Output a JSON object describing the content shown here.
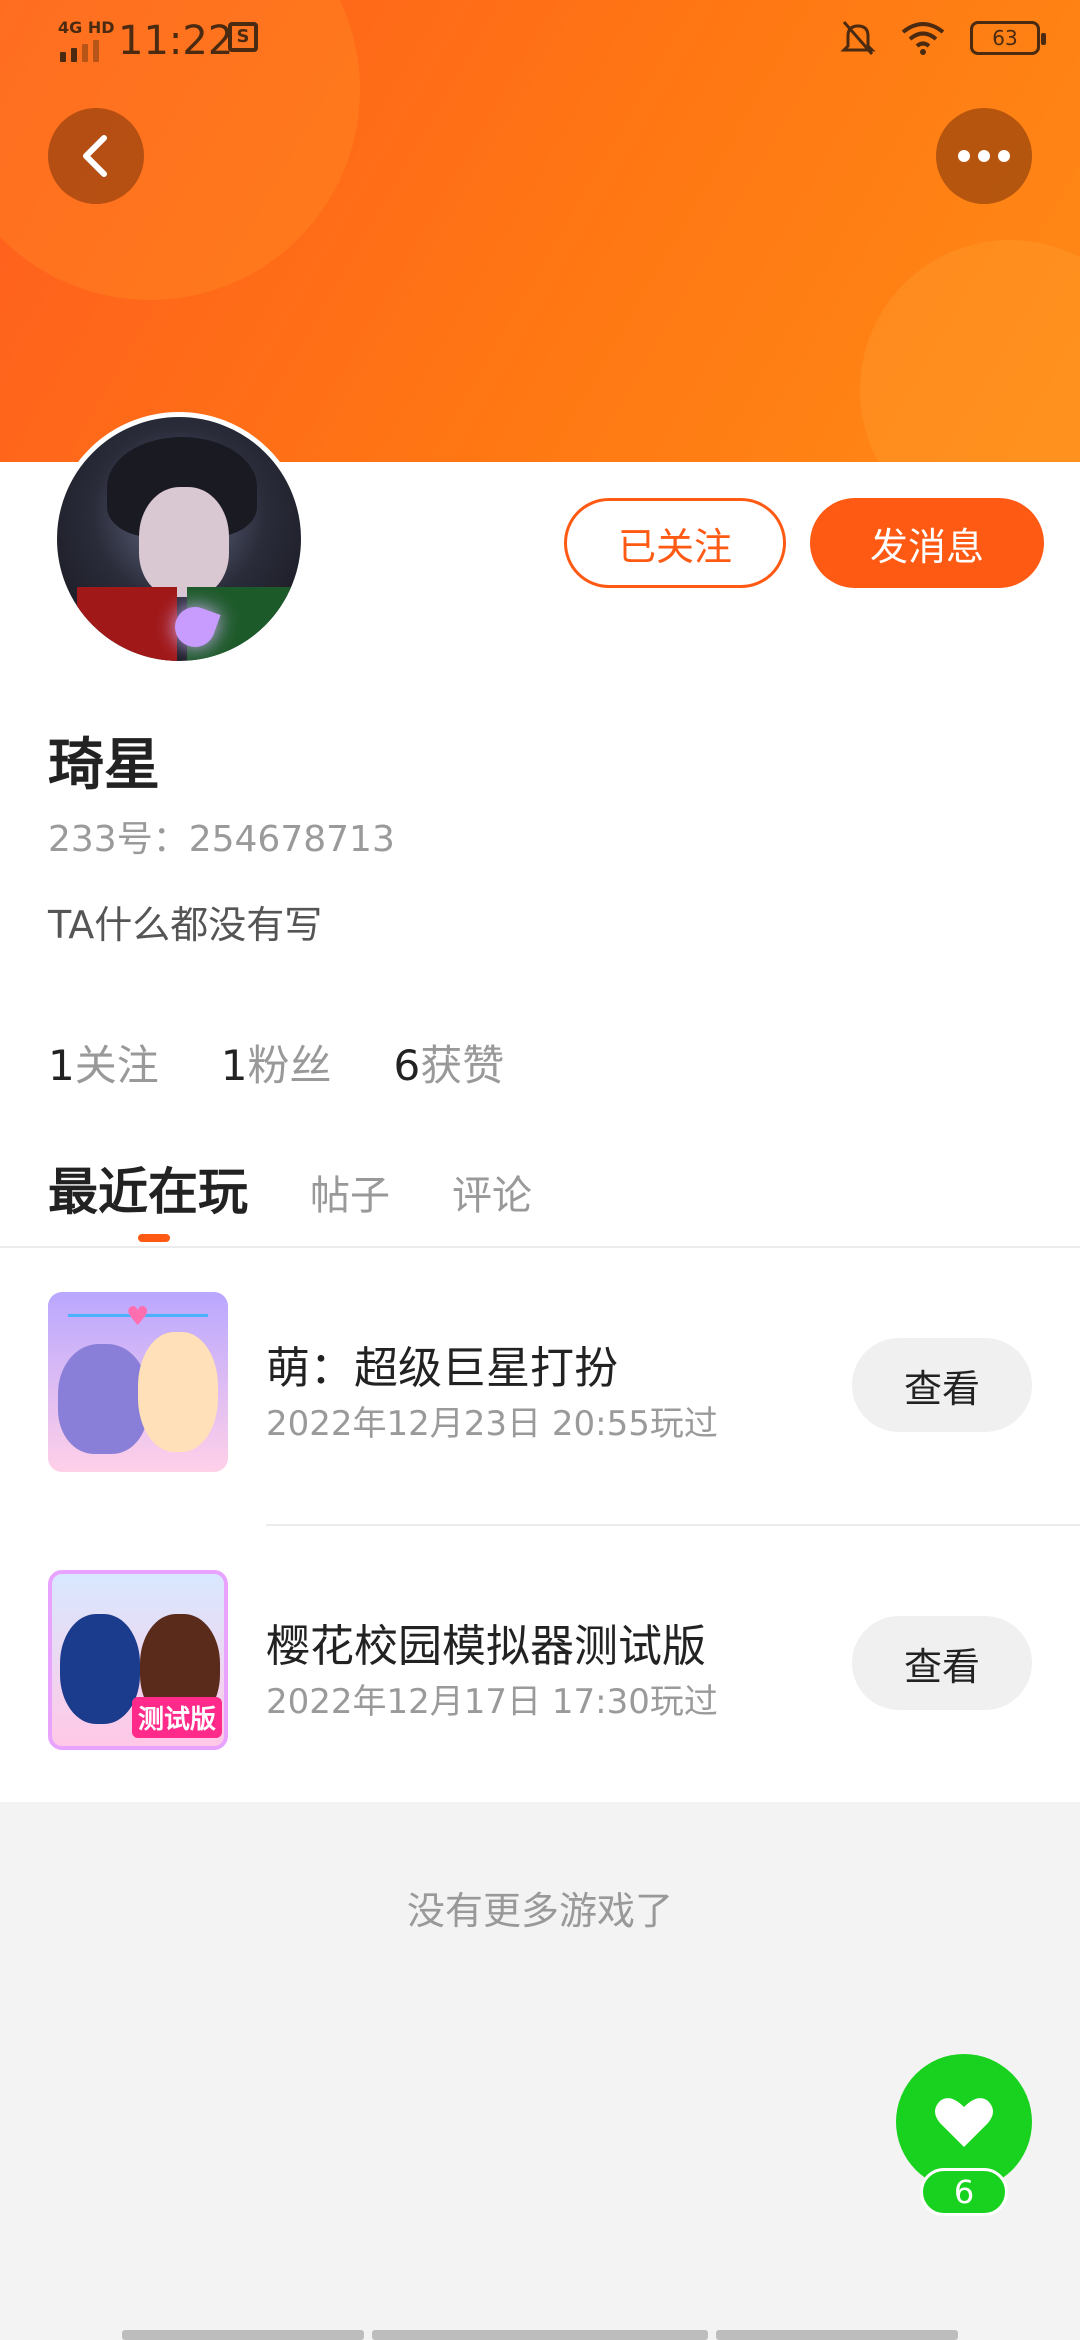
{
  "status_bar": {
    "network": "4G HD",
    "time": "11:22",
    "sim_icon_text": "S",
    "battery": "63"
  },
  "header": {
    "back_icon": "chevron-left-icon",
    "more_icon": "more-dots-icon",
    "gradient_start": "#ff5d1f",
    "gradient_end": "#ff8a16"
  },
  "profile": {
    "username": "琦星",
    "user_id": "233号：254678713",
    "bio": "TA什么都没有写",
    "followed_label": "已关注",
    "message_label": "发消息",
    "stats": [
      {
        "num": "1",
        "label": "关注"
      },
      {
        "num": "1",
        "label": "粉丝"
      },
      {
        "num": "6",
        "label": "获赞"
      }
    ]
  },
  "tabs": [
    {
      "label": "最近在玩",
      "active": true
    },
    {
      "label": "帖子",
      "active": false
    },
    {
      "label": "评论",
      "active": false
    }
  ],
  "games": [
    {
      "title": "萌：超级巨星打扮",
      "played": "2022年12月23日 20:55玩过",
      "action": "查看"
    },
    {
      "title": "樱花校园模拟器测试版",
      "played": "2022年12月17日 17:30玩过",
      "action": "查看",
      "icon_tag": "测试版"
    }
  ],
  "footer": {
    "no_more": "没有更多游戏了",
    "like_count": "6",
    "like_icon": "heart-icon"
  },
  "colors": {
    "accent": "#ff5a14",
    "like_green": "#19d21f"
  }
}
